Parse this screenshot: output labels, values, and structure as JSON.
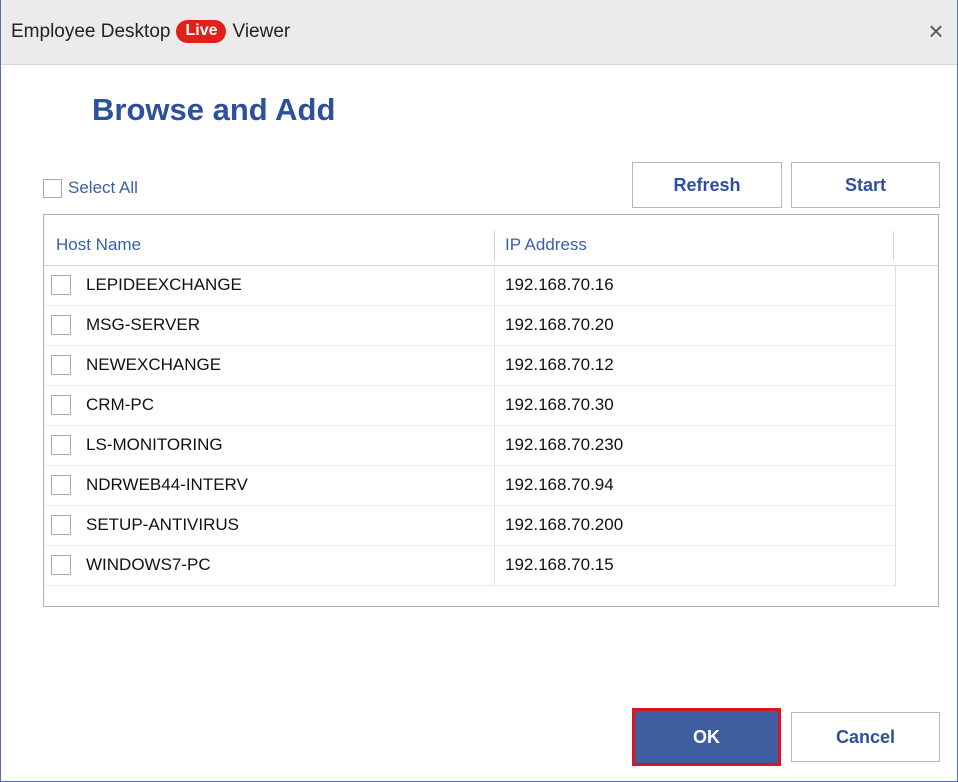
{
  "window": {
    "title_prefix": "Employee Desktop",
    "title_badge": "Live",
    "title_suffix": "Viewer",
    "close_glyph": "×"
  },
  "heading": "Browse and Add",
  "select_all_label": "Select All",
  "buttons": {
    "refresh": "Refresh",
    "start": "Start",
    "ok": "OK",
    "cancel": "Cancel"
  },
  "colors": {
    "accent": "#2e4f9a",
    "live_badge": "#e0201b",
    "ok_button_bg": "#3f5d9f",
    "ok_button_highlight": "#d8161f"
  },
  "table": {
    "columns": [
      "Host Name",
      "IP Address"
    ],
    "rows": [
      {
        "host": "LEPIDEEXCHANGE",
        "ip": "192.168.70.16",
        "checked": false
      },
      {
        "host": "MSG-SERVER",
        "ip": "192.168.70.20",
        "checked": false
      },
      {
        "host": "NEWEXCHANGE",
        "ip": "192.168.70.12",
        "checked": false
      },
      {
        "host": "CRM-PC",
        "ip": "192.168.70.30",
        "checked": false
      },
      {
        "host": "LS-MONITORING",
        "ip": "192.168.70.230",
        "checked": false
      },
      {
        "host": "NDRWEB44-INTERV",
        "ip": "192.168.70.94",
        "checked": false
      },
      {
        "host": "SETUP-ANTIVIRUS",
        "ip": "192.168.70.200",
        "checked": false
      },
      {
        "host": "WINDOWS7-PC",
        "ip": "192.168.70.15",
        "checked": false
      }
    ]
  }
}
